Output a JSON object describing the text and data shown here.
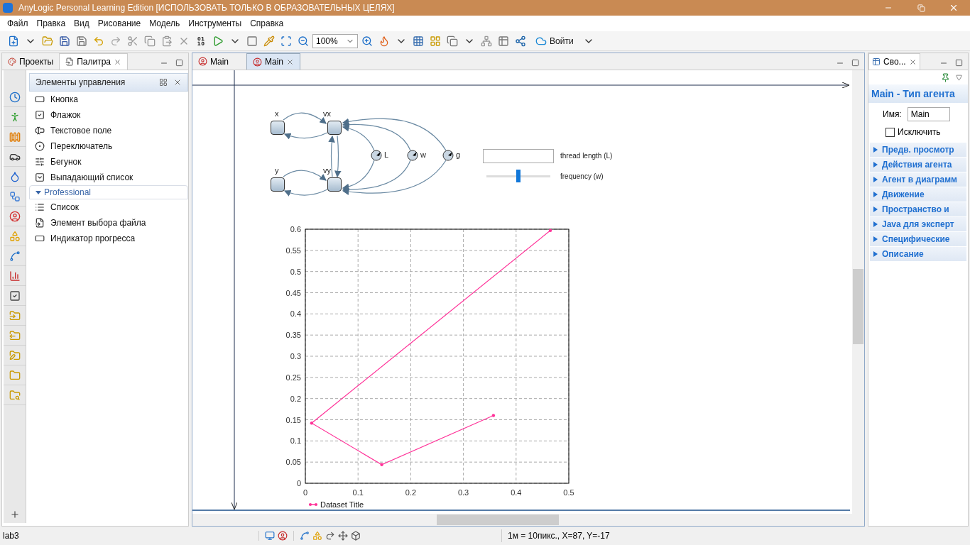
{
  "window": {
    "title": "AnyLogic Personal Learning Edition [ИСПОЛЬЗОВАТЬ ТОЛЬКО В ОБРАЗОВАТЕЛЬНЫХ ЦЕЛЯХ]"
  },
  "menu": [
    "Файл",
    "Правка",
    "Вид",
    "Рисование",
    "Модель",
    "Инструменты",
    "Справка"
  ],
  "toolbar": {
    "zoom": "100%",
    "login": "Войти"
  },
  "left_tabs": [
    {
      "label": "Проекты",
      "selected": false
    },
    {
      "label": "Палитра",
      "selected": true
    }
  ],
  "palette": {
    "title": "Элементы управления",
    "items": [
      "Кнопка",
      "Флажок",
      "Текстовое поле",
      "Переключатель",
      "Бегунок",
      "Выпадающий список"
    ],
    "sections": [
      {
        "title": "Professional",
        "expanded": true,
        "items": [
          "Список",
          "Элемент выбора файла",
          "Индикатор прогресса"
        ]
      }
    ]
  },
  "editor_tabs": [
    {
      "label": "Main",
      "selected": false
    },
    {
      "label": "Main",
      "selected": true
    }
  ],
  "diagram": {
    "stocks": [
      {
        "label": "x"
      },
      {
        "label": "vx"
      },
      {
        "label": "y"
      },
      {
        "label": "vy"
      }
    ],
    "parameters": [
      {
        "label": "L"
      },
      {
        "label": "w"
      },
      {
        "label": "g"
      }
    ],
    "controls": [
      {
        "kind": "field",
        "label": "thread length (L)"
      },
      {
        "kind": "slider",
        "label": "frequency (w)",
        "level": 0.5
      }
    ],
    "chart_data": {
      "type": "line",
      "x": [
        0.465,
        0.012,
        0.145,
        0.357
      ],
      "series": [
        {
          "name": "Dataset Title",
          "color": "#ff3399",
          "values": [
            0.597,
            0.142,
            0.044,
            0.16
          ]
        }
      ],
      "grid": true,
      "xlim": [
        0,
        0.5
      ],
      "ylim": [
        0,
        0.6
      ],
      "xticks": [
        0,
        0.1,
        0.2,
        0.3,
        0.4,
        0.5
      ],
      "yticks": [
        0,
        0.05,
        0.1,
        0.15,
        0.2,
        0.25,
        0.3,
        0.35,
        0.4,
        0.45,
        0.5,
        0.55,
        0.6
      ]
    }
  },
  "properties": {
    "tab": "Сво...",
    "title": "Main - Тип агента",
    "name_label": "Имя:",
    "name_value": "Main",
    "exclude": {
      "label": "Исключить",
      "checked": false
    },
    "sections": [
      {
        "title": "Предв. просмотр",
        "expanded": false
      },
      {
        "title": "Действия агента",
        "expanded": false
      },
      {
        "title": "Агент в диаграмм",
        "expanded": false
      },
      {
        "title": "Движение",
        "expanded": false
      },
      {
        "title": "Пространство и",
        "expanded": false
      },
      {
        "title": "Java для эксперт",
        "expanded": false
      },
      {
        "title": "Специфические",
        "expanded": false
      },
      {
        "title": "Описание",
        "expanded": false
      }
    ]
  },
  "status_bar": {
    "project": "lab3",
    "coords": "1м = 10пикс., X=87, Y=-17"
  }
}
